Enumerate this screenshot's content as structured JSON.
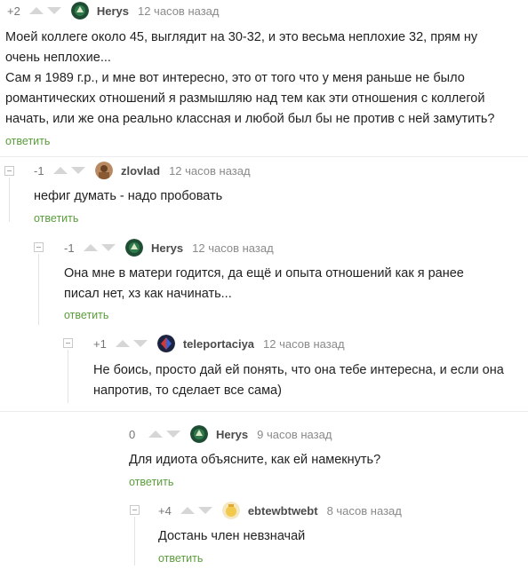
{
  "comments": [
    {
      "rating": "+2",
      "author": "Herys",
      "time": "12 часов назад",
      "lines": [
        "Моей коллеге около 45, выглядит на 30-32, и это весьма неплохие 32, прям ну",
        "очень неплохие...",
        "Сам я 1989 г.р., и мне вот интересно, это от того что у меня раньше не было",
        "романтических отношений я размышляю над тем как эти отношения с коллегой",
        "начать, или же она реально классная и любой был бы не против с ней замутить?"
      ],
      "reply": "ответить"
    },
    {
      "rating": "-1",
      "author": "zlovlad",
      "time": "12 часов назад",
      "lines": [
        "нефиг думать - надо пробовать"
      ],
      "reply": "ответить"
    },
    {
      "rating": "-1",
      "author": "Herys",
      "time": "12 часов назад",
      "lines": [
        "Она мне в матери годится, да ещё и опыта отношений как я ранее",
        "писал нет, хз как начинать..."
      ],
      "reply": "ответить"
    },
    {
      "rating": "+1",
      "author": "teleportaciya",
      "time": "12 часов назад",
      "lines": [
        "Не боись, просто дай ей понять, что она тебе интересна, и если она",
        "напротив, то сделает все сама)"
      ]
    },
    {
      "rating": "0",
      "author": "Herys",
      "time": "9 часов назад",
      "lines": [
        "Для идиота объясните, как ей намекнуть?"
      ],
      "reply": "ответить"
    },
    {
      "rating": "+4",
      "author": "ebtewbtwebt",
      "time": "8 часов назад",
      "lines": [
        "Достань член невзначай"
      ],
      "reply": "ответить"
    }
  ],
  "colors": {
    "reply_link": "#5a9d3b",
    "arrow": "#d6d6d6",
    "author": "#4b4b4b",
    "time": "#8a8a8a"
  },
  "icons": {
    "vote_up": "triangle-up-icon",
    "vote_down": "triangle-down-icon",
    "collapse": "minus-box-icon"
  }
}
